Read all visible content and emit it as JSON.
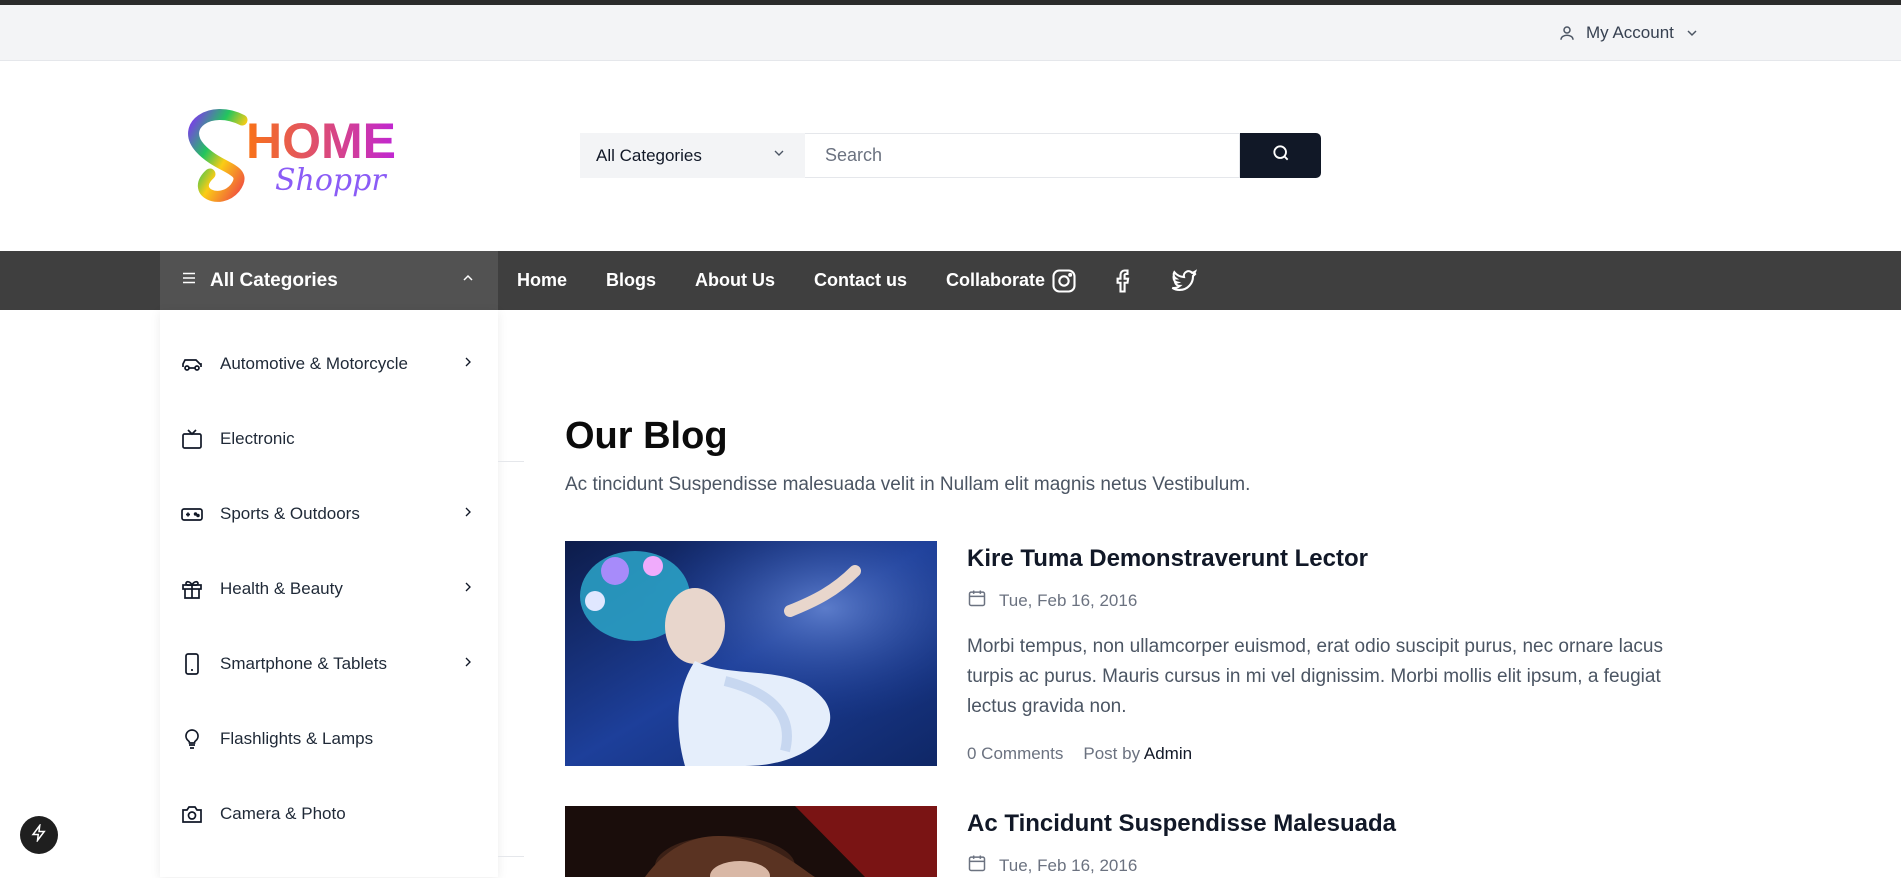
{
  "topbar": {
    "account_label": "My Account"
  },
  "logo": {
    "word_top": "HOME",
    "word_bottom": "Shoppr"
  },
  "search": {
    "category_label": "All Categories",
    "placeholder": "Search"
  },
  "nav": {
    "all_categories": "All Categories",
    "links": [
      "Home",
      "Blogs",
      "About Us",
      "Contact us",
      "Collaborate"
    ]
  },
  "categories": [
    {
      "label": "Automotive & Motorcycle",
      "icon": "car-icon",
      "has_sub": true
    },
    {
      "label": "Electronic",
      "icon": "tv-icon",
      "has_sub": false
    },
    {
      "label": "Sports & Outdoors",
      "icon": "gamepad-icon",
      "has_sub": true
    },
    {
      "label": "Health & Beauty",
      "icon": "gift-icon",
      "has_sub": true
    },
    {
      "label": "Smartphone & Tablets",
      "icon": "smartphone-icon",
      "has_sub": true
    },
    {
      "label": "Flashlights & Lamps",
      "icon": "lightbulb-icon",
      "has_sub": false
    },
    {
      "label": "Camera & Photo",
      "icon": "camera-icon",
      "has_sub": false
    }
  ],
  "blog": {
    "title": "Our Blog",
    "subtitle": "Ac tincidunt Suspendisse malesuada velit in Nullam elit magnis netus Vestibulum.",
    "posts": [
      {
        "title": "Kire Tuma Demonstraverunt Lector",
        "date": "Tue, Feb 16, 2016",
        "excerpt": "Morbi tempus, non ullamcorper euismod, erat odio suscipit purus, nec ornare lacus turpis ac purus. Mauris cursus in mi vel dignissim. Morbi mollis elit ipsum, a feugiat lectus gravida non.",
        "comments": "0 Comments",
        "post_by": "Post by",
        "author": "Admin"
      },
      {
        "title": "Ac Tincidunt Suspendisse Malesuada",
        "date": "Tue, Feb 16, 2016"
      }
    ]
  },
  "colors": {
    "navbar": "#3f3f3f",
    "allcat": "#525252",
    "search_button": "#111827",
    "topbar": "#f3f4f6"
  }
}
